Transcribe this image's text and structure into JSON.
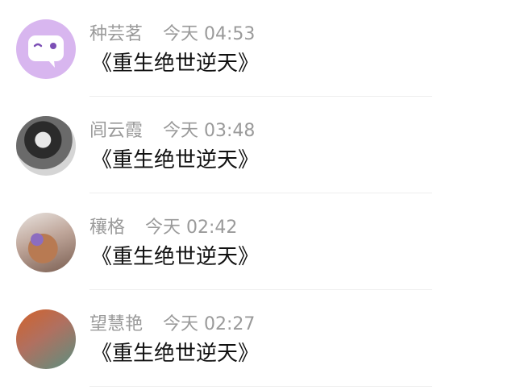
{
  "messages": [
    {
      "name": "种芸茗",
      "time": "今天 04:53",
      "text": "《重生绝世逆天》",
      "avatar": "chat-bubble-avatar"
    },
    {
      "name": "闾云霞",
      "time": "今天 03:48",
      "text": "《重生绝世逆天》",
      "avatar": "photo-avatar"
    },
    {
      "name": "穰格",
      "time": "今天 02:42",
      "text": "《重生绝世逆天》",
      "avatar": "photo-avatar"
    },
    {
      "name": "望慧艳",
      "time": "今天 02:27",
      "text": "《重生绝世逆天》",
      "avatar": "gradient-avatar"
    }
  ],
  "colors": {
    "name_text": "#9a9a9a",
    "message_text": "#111111",
    "avatar1": "#d8b6ef",
    "divider": "#eeeeee"
  }
}
